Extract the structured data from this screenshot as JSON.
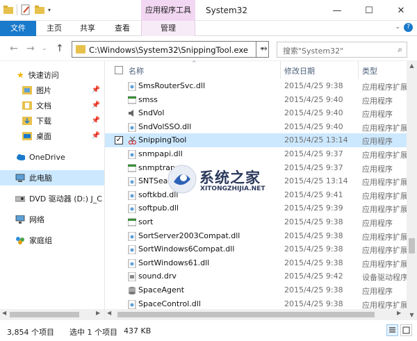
{
  "window": {
    "title": "System32",
    "context_tab": "应用程序工具",
    "minimize": "—",
    "maximize": "☐",
    "close": "✕"
  },
  "ribbon": {
    "file": "文件",
    "tabs": [
      "主页",
      "共享",
      "查看",
      "管理"
    ]
  },
  "address": {
    "path": "C:\\Windows\\System32\\SnippingTool.exe",
    "search_placeholder": "搜索\"System32\""
  },
  "nav": {
    "quick_access": "快速访问",
    "pinned": [
      "图片",
      "文档",
      "下载",
      "桌面"
    ],
    "onedrive": "OneDrive",
    "this_pc": "此电脑",
    "dvd": "DVD 驱动器 (D:) J_C",
    "network": "网络",
    "homegroup": "家庭组"
  },
  "columns": {
    "name": "名称",
    "date": "修改日期",
    "type": "类型"
  },
  "files": [
    {
      "name": "SmsRouterSvc.dll",
      "date": "2015/4/25 9:38",
      "type": "应用程序扩展",
      "icon": "dll"
    },
    {
      "name": "smss",
      "date": "2015/4/25 9:40",
      "type": "应用程序",
      "icon": "exe"
    },
    {
      "name": "SndVol",
      "date": "2015/4/25 9:40",
      "type": "应用程序",
      "icon": "speaker"
    },
    {
      "name": "SndVolSSO.dll",
      "date": "2015/4/25 9:40",
      "type": "应用程序扩展",
      "icon": "dll"
    },
    {
      "name": "SnippingTool",
      "date": "2015/4/25 13:14",
      "type": "应用程序",
      "icon": "snip"
    },
    {
      "name": "snmpapi.dll",
      "date": "2015/4/25 9:37",
      "type": "应用程序扩展",
      "icon": "dll"
    },
    {
      "name": "snmptrap",
      "date": "2015/4/25 9:37",
      "type": "应用程序",
      "icon": "exe"
    },
    {
      "name": "SNTSearch.dll",
      "date": "2015/4/25 13:14",
      "type": "应用程序扩展",
      "icon": "dll"
    },
    {
      "name": "softkbd.dll",
      "date": "2015/4/25 9:41",
      "type": "应用程序扩展",
      "icon": "dll"
    },
    {
      "name": "softpub.dll",
      "date": "2015/4/25 9:39",
      "type": "应用程序扩展",
      "icon": "dll"
    },
    {
      "name": "sort",
      "date": "2015/4/25 9:38",
      "type": "应用程序",
      "icon": "exe"
    },
    {
      "name": "SortServer2003Compat.dll",
      "date": "2015/4/25 9:38",
      "type": "应用程序扩展",
      "icon": "dll"
    },
    {
      "name": "SortWindows6Compat.dll",
      "date": "2015/4/25 9:38",
      "type": "应用程序扩展",
      "icon": "dll"
    },
    {
      "name": "SortWindows61.dll",
      "date": "2015/4/25 9:38",
      "type": "应用程序扩展",
      "icon": "dll"
    },
    {
      "name": "sound.drv",
      "date": "2015/4/25 9:42",
      "type": "设备驱动程序",
      "icon": "drv"
    },
    {
      "name": "SpaceAgent",
      "date": "2015/4/25 9:38",
      "type": "应用程序",
      "icon": "disk"
    },
    {
      "name": "SpaceControl.dll",
      "date": "2015/4/25 9:38",
      "type": "应用程序扩展",
      "icon": "dll"
    }
  ],
  "status": {
    "count": "3,854 个项目",
    "selected": "选中 1 个项目",
    "size": "437 KB"
  },
  "watermark": {
    "title": "系统之家",
    "url": "XITONGZHIJIA.NET"
  }
}
